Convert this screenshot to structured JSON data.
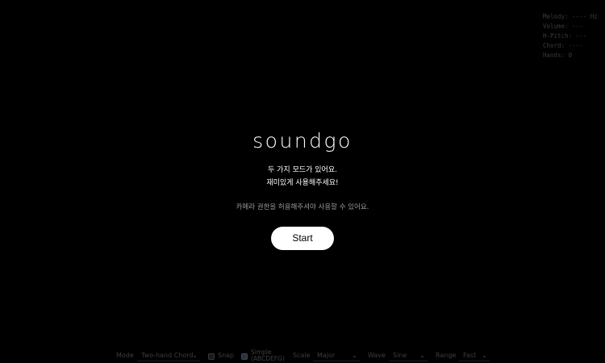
{
  "readout": {
    "melody": "Melody: ---- Hz",
    "volume": "Volume: ---",
    "h_pitch": "H-Pitch: ---",
    "chord": "Chord: ----",
    "hands": "Hands: 0"
  },
  "hero": {
    "title": "soundgo",
    "desc_line1": "두 가지 모드가 있어요.",
    "desc_line2": "재미있게 사용해주세요!",
    "camera_note": "카메라 권한을 허용해주셔야 사용할 수 있어요.",
    "start_label": "Start"
  },
  "controls": {
    "mode_label": "Mode",
    "mode_value": "Two-hand Chord",
    "snap_label": "Snap",
    "snap_checked": false,
    "simple_label": "Simple (ABCDEFG)",
    "simple_checked": true,
    "scale_label": "Scale",
    "scale_value": "Major",
    "wave_label": "Wave",
    "wave_value": "Sine",
    "range_label": "Range",
    "range_value": "Fast"
  },
  "colors": {
    "background": "#000000",
    "button_bg": "#ffffff",
    "button_text": "#000000",
    "muted_text": "#9a9a9a"
  },
  "icons": {
    "dropdown": "chevron-down-icon"
  }
}
